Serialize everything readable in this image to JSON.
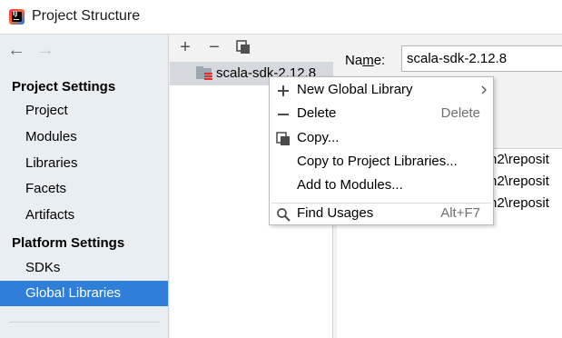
{
  "window": {
    "title": "Project Structure"
  },
  "nav": {
    "back_icon": "←",
    "forward_icon": "→",
    "sections": [
      {
        "title": "Project Settings",
        "items": [
          "Project",
          "Modules",
          "Libraries",
          "Facets",
          "Artifacts"
        ]
      },
      {
        "title": "Platform Settings",
        "items": [
          "SDKs",
          "Global Libraries"
        ]
      }
    ],
    "selected": "Global Libraries"
  },
  "toolbar": {
    "add_icon": "+",
    "remove_icon": "−",
    "copy_icon": "copy-icon"
  },
  "libraries": [
    {
      "name": "scala-sdk-2.12.8"
    }
  ],
  "details": {
    "name_label": "Name:",
    "name_value": "scala-sdk-2.12.8",
    "paths": [
      "n2\\reposit",
      "n2\\reposit",
      "n2\\reposit"
    ]
  },
  "context_menu": {
    "items": [
      {
        "label": "New Global Library",
        "shortcut": "",
        "icon": "plus-icon",
        "submenu": true
      },
      {
        "label": "Delete",
        "shortcut": "Delete",
        "icon": "minus-icon",
        "submenu": false
      },
      {
        "label": "Copy...",
        "shortcut": "",
        "icon": "copy-icon",
        "submenu": false
      },
      {
        "label": "Copy to Project Libraries...",
        "shortcut": "",
        "icon": "",
        "submenu": false
      },
      {
        "label": "Add to Modules...",
        "shortcut": "",
        "icon": "",
        "submenu": false
      },
      {
        "label": "Find Usages",
        "shortcut": "Alt+F7",
        "icon": "search-icon",
        "submenu": false
      }
    ]
  },
  "colors": {
    "selection": "#2f7ed8",
    "nav_background": "#e9eef3",
    "library_badge": "#e0332e"
  }
}
